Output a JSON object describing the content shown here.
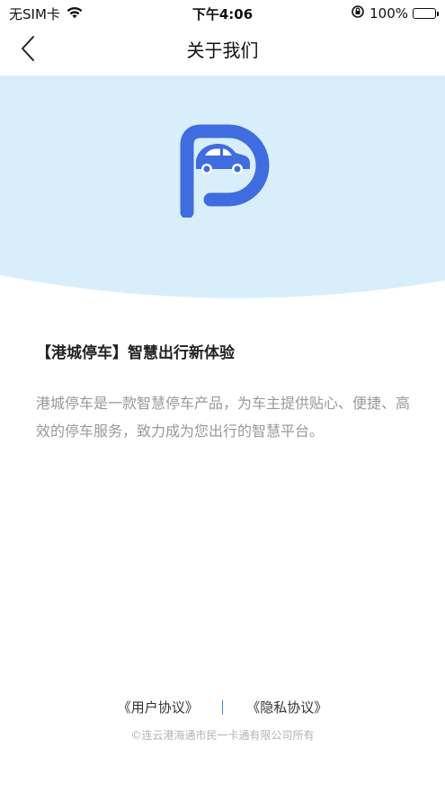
{
  "status_bar": {
    "carrier": "无SIM卡",
    "time": "下午4:06",
    "battery": "100%"
  },
  "nav": {
    "title": "关于我们"
  },
  "intro": {
    "heading": "【港城停车】智慧出行新体验",
    "body": "港城停车是一款智慧停车产品，为车主提供贴心、便捷、高效的停车服务，致力成为您出行的智慧平台。"
  },
  "footer": {
    "user_agreement": "《用户协议》",
    "privacy_agreement": "《隐私协议》",
    "copyright": "©连云港海通市民一卡通有限公司所有"
  },
  "colors": {
    "brand": "#3F6CDF",
    "hero_bg": "#D8EEFB"
  },
  "icons": {
    "signal": "wifi-icon",
    "back": "chevron-left-icon",
    "logo": "parking-p-car-logo"
  }
}
